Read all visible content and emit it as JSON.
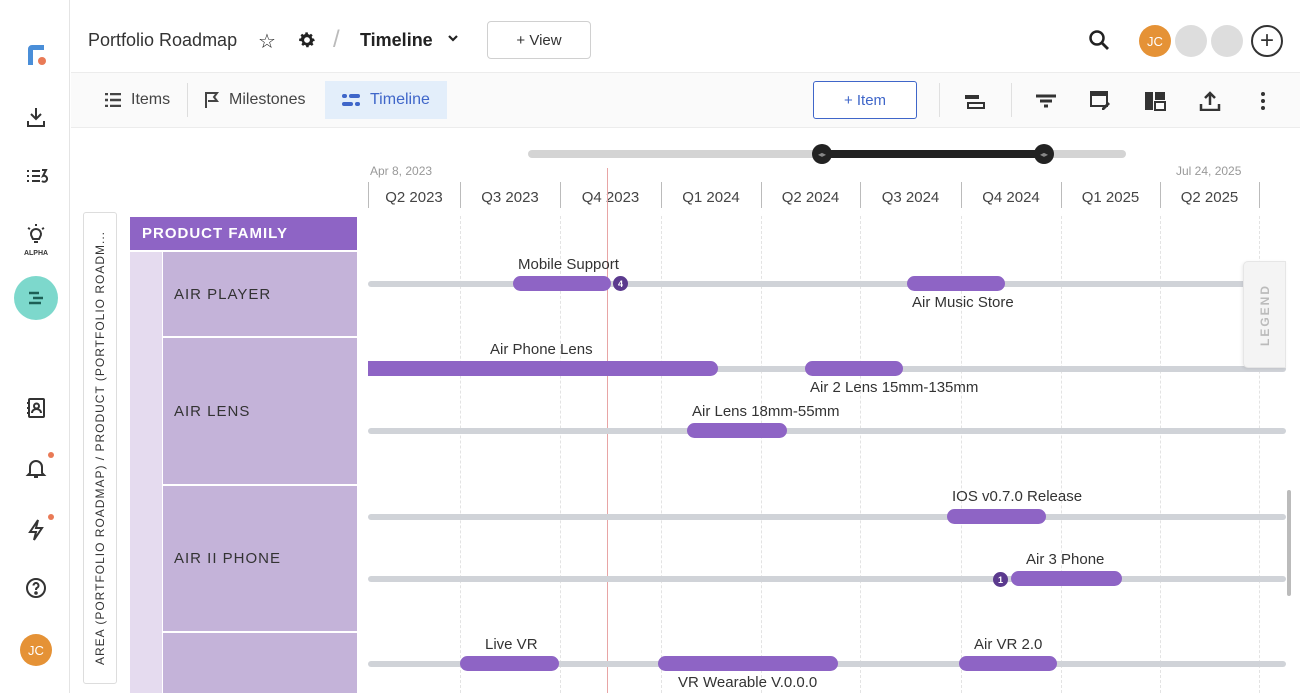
{
  "header": {
    "project_title": "Portfolio Roadmap",
    "separator": "/",
    "view_title": "Timeline",
    "add_view_label": "+ View",
    "user_initials": "JC"
  },
  "toolbar": {
    "tabs": [
      {
        "label": "Items",
        "icon": "list-icon"
      },
      {
        "label": "Milestones",
        "icon": "flag-icon"
      },
      {
        "label": "Timeline",
        "icon": "timeline-icon",
        "active": true
      }
    ],
    "add_item_label": "+ Item",
    "icons": [
      "row-height-icon",
      "filter-icon",
      "edit-view-icon",
      "layout-icon",
      "export-icon",
      "more-icon"
    ]
  },
  "rail": {
    "alpha_label": "ALPHA",
    "user_initials": "JC",
    "icons": [
      "logo",
      "import-icon",
      "sprint-icon",
      "idea-icon",
      "roadmap-icon",
      "contacts-icon",
      "bell-icon",
      "lightning-icon",
      "help-icon"
    ]
  },
  "timeline": {
    "range_start": "Apr 8, 2023",
    "range_end": "Jul 24, 2025",
    "quarters": [
      "Q2 2023",
      "Q3 2023",
      "Q4 2023",
      "Q1 2024",
      "Q2 2024",
      "Q3 2024",
      "Q4 2024",
      "Q1 2025",
      "Q2 2025"
    ],
    "grouping_label": "AREA (PORTFOLIO ROADMAP) / PRODUCT (PORTFOLIO ROADM...",
    "family_header": "PRODUCT FAMILY",
    "products": [
      {
        "name": "AIR PLAYER"
      },
      {
        "name": "AIR LENS"
      },
      {
        "name": "AIR II PHONE"
      },
      {
        "name": ""
      }
    ],
    "items": [
      {
        "label": "Mobile Support",
        "badge": "4"
      },
      {
        "label": "Air Music Store"
      },
      {
        "label": "Air Phone Lens"
      },
      {
        "label": "Air 2 Lens 15mm-135mm"
      },
      {
        "label": "Air Lens 18mm-55mm"
      },
      {
        "label": "IOS v0.7.0 Release"
      },
      {
        "label": "Air 3 Phone",
        "badge": "1"
      },
      {
        "label": "Live VR"
      },
      {
        "label": "VR Wearable V.0.0.0"
      },
      {
        "label": "Air VR 2.0"
      }
    ],
    "legend_label": "LEGEND"
  },
  "colors": {
    "bar": "#8e64c5",
    "family_header": "#8e64c5",
    "product_row": "#c4b3d9",
    "accent_blue": "#3f66c9",
    "rail_active": "#7dd8cc",
    "avatar": "#e59236"
  }
}
